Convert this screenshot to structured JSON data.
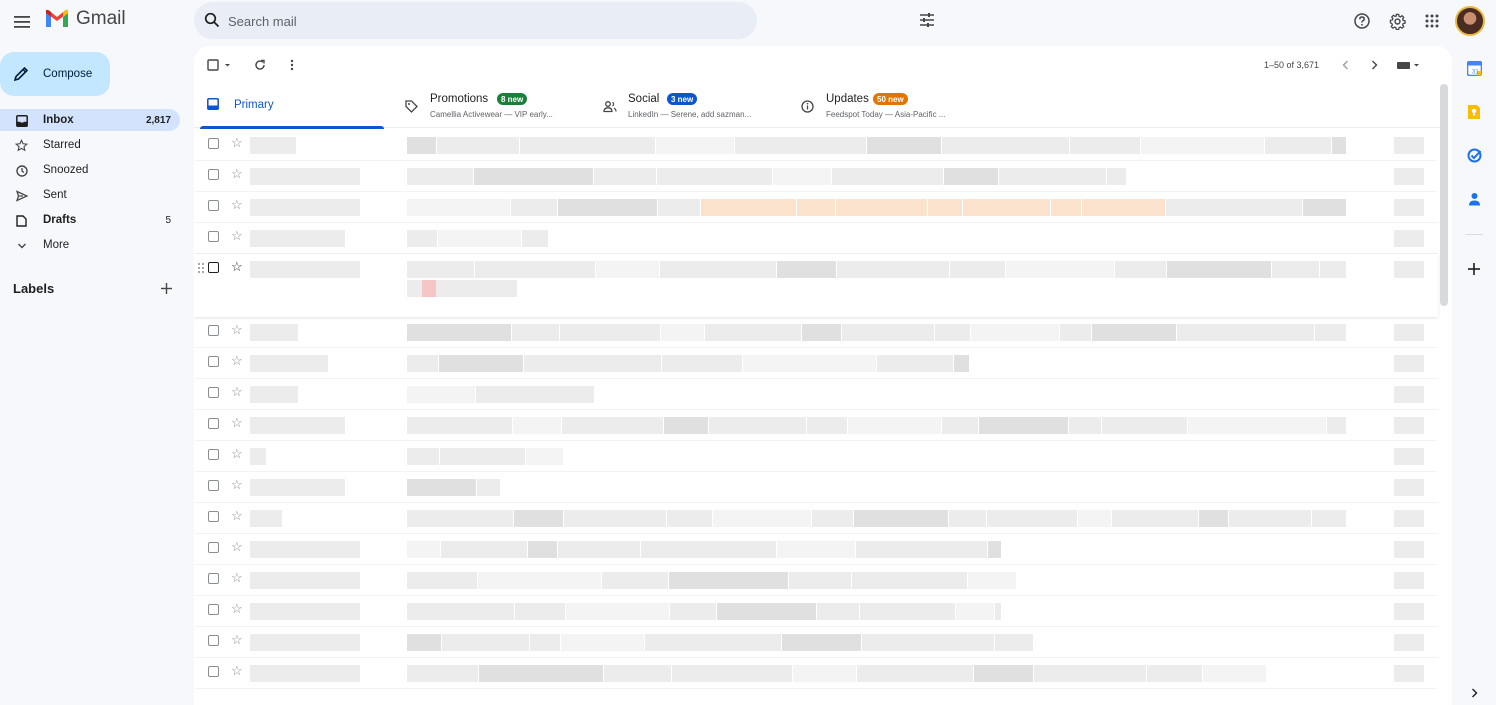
{
  "app": {
    "name": "Gmail"
  },
  "search": {
    "placeholder": "Search mail"
  },
  "compose": {
    "label": "Compose"
  },
  "nav": {
    "items": [
      {
        "label": "Inbox",
        "count": "2,817",
        "active": true,
        "bold": true,
        "icon": "inbox-icon"
      },
      {
        "label": "Starred",
        "count": "",
        "icon": "star-icon"
      },
      {
        "label": "Snoozed",
        "count": "",
        "icon": "clock-icon"
      },
      {
        "label": "Sent",
        "count": "",
        "icon": "send-icon"
      },
      {
        "label": "Drafts",
        "count": "5",
        "bold": true,
        "icon": "draft-icon"
      },
      {
        "label": "More",
        "count": "",
        "icon": "chevron-down-icon"
      }
    ],
    "labels_title": "Labels"
  },
  "toolbar": {
    "pagination": "1–50 of 3,671"
  },
  "tabs": {
    "primary": {
      "label": "Primary"
    },
    "promotions": {
      "label": "Promotions",
      "badge": "8 new",
      "badge_color": "#188038",
      "snippet": "Camellia Activewear — VIP early..."
    },
    "social": {
      "label": "Social",
      "badge": "3 new",
      "badge_color": "#0b57d0",
      "snippet": "LinkedIn — Serene, add sazman..."
    },
    "updates": {
      "label": "Updates",
      "badge": "50 new",
      "badge_color": "#e37400",
      "snippet": "Feedspot Today — Asia-Pacific ..."
    }
  },
  "colors": {
    "accent": "#0b57d0",
    "compose_bg": "#c2e7ff",
    "active_nav_bg": "#d3e3fd",
    "search_bg": "#e9eef6"
  },
  "side_panel": [
    "calendar-icon",
    "keep-icon",
    "tasks-icon",
    "contacts-icon",
    "add-icon"
  ]
}
